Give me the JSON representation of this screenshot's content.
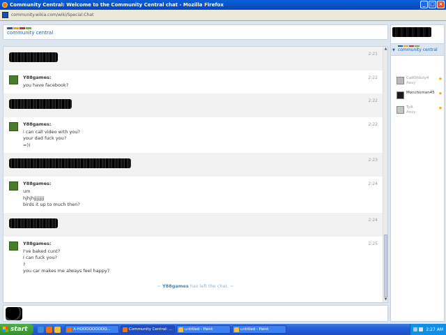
{
  "window": {
    "title": "Community Central: Welcome to the Community Central chat - Mozilla Firefox",
    "url": "community.wikia.com/wiki/Special:Chat"
  },
  "header": {
    "logo_text": "community central"
  },
  "messages": [
    {
      "user": "",
      "time": "2:21",
      "lines": [],
      "redacted": true,
      "alt": true
    },
    {
      "user": "Y88games:",
      "time": "2:22",
      "lines": [
        "you have facebook?"
      ],
      "redacted": false,
      "alt": false
    },
    {
      "user": "",
      "time": "2:22",
      "lines": [],
      "redacted": true,
      "alt": true
    },
    {
      "user": "Y88games:",
      "time": "2:22",
      "lines": [
        "i can call video with you?",
        "your dad fuck you?",
        "=))"
      ],
      "redacted": false,
      "alt": false
    },
    {
      "user": "",
      "time": "2:23",
      "lines": [],
      "redacted": true,
      "alt": true
    },
    {
      "user": "Y88games:",
      "time": "2:24",
      "lines": [
        "um",
        "hjhjhjjjjjjjj",
        "birds it up to much then?"
      ],
      "redacted": false,
      "alt": false
    },
    {
      "user": "",
      "time": "2:24",
      "lines": [],
      "redacted": true,
      "alt": true
    },
    {
      "user": "Y88games:",
      "time": "2:25",
      "lines": [
        "I've baked cunt?",
        "I can fuck you?",
        "?",
        "you car makes me always feel happy?"
      ],
      "redacted": false,
      "alt": false
    }
  ],
  "leave_notice": {
    "prefix": "~ ",
    "user": "Y88games",
    "suffix": " has left the chat. ~"
  },
  "input": {
    "value": ""
  },
  "userlist": {
    "room_label": "community central",
    "users": [
      {
        "name": "CallOfduty4",
        "status": "Away",
        "away": true
      },
      {
        "name": "Monchoman45",
        "status": "",
        "away": false
      },
      {
        "name": "TyA",
        "status": "Away",
        "away": true
      }
    ]
  },
  "taskbar": {
    "start_label": "start",
    "tasks": [
      "X-HOOOOOOOOO...",
      "Community Central: ...",
      "untitled - Paint",
      "untitled - Paint"
    ],
    "clock": "2:27 AM"
  },
  "colors": {
    "accent": "#1d5ea8",
    "star": "#f2a11b",
    "taskbar": "#245ed8",
    "start": "#33912e"
  }
}
